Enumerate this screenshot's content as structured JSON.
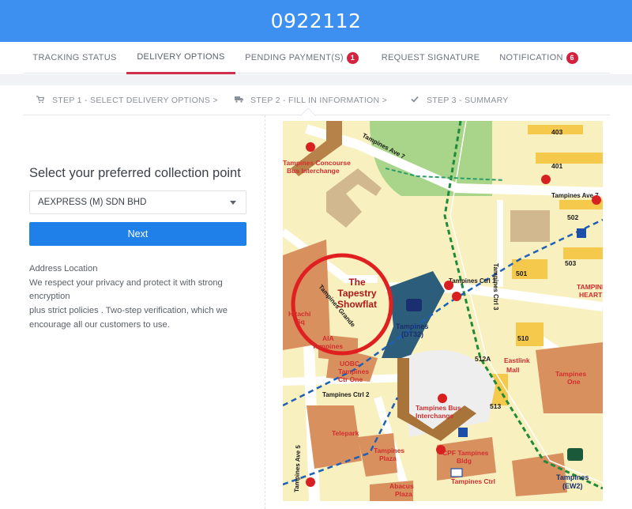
{
  "header": {
    "title": "0922112"
  },
  "tabs": [
    {
      "label": "TRACKING STATUS"
    },
    {
      "label": "DELIVERY OPTIONS"
    },
    {
      "label": "PENDING PAYMENT(S)",
      "badge": "1"
    },
    {
      "label": "REQUEST SIGNATURE"
    },
    {
      "label": "NOTIFICATION",
      "badge": "6"
    }
  ],
  "steps": [
    {
      "label": "STEP 1 - SELECT DELIVERY OPTIONS >",
      "icon": "cart-icon"
    },
    {
      "label": "STEP 2 - FILL IN INFORMATION >",
      "icon": "truck-icon"
    },
    {
      "label": "STEP 3 - SUMMARY",
      "icon": "check-icon"
    }
  ],
  "form": {
    "prompt": "Select your preferred collection point",
    "selected_option": "AEXPRESS (M) SDN BHD",
    "next_label": "Next"
  },
  "address": {
    "heading": "Address Location",
    "line1": "We respect your privacy and protect it with strong encryption",
    "line2": "plus strict policies . Two-step verification, which we encourage all our customers to use."
  },
  "map": {
    "highlight": [
      "The",
      "Tapestry",
      "Showflat"
    ],
    "roads": [
      "Tampines Ave 7",
      "Tampines Ave 5",
      "Tampines Ctrl 1",
      "Tampines Ctrl 2",
      "Tampines Ctrl 3",
      "Tampines Grande"
    ],
    "places": [
      "Tampines Concourse",
      "Bus Interchange",
      "Hitachi",
      "Sq",
      "AIA",
      "Tampines",
      "UOBC",
      "Tampines",
      "Ctr One",
      "Telepark",
      "Tampines",
      "Plaza",
      "Abacus",
      "Plaza",
      "Tampines Bus",
      "Interchange",
      "CPF Tampines",
      "Bldg",
      "Tampines Ctrl",
      "Eastlink",
      "Mall",
      "Tampines",
      "One",
      "TAMPINES",
      "HEART"
    ],
    "stations": [
      {
        "name": "Tampines",
        "code": "(DT32)"
      },
      {
        "name": "Tampines",
        "code": "(EW2)"
      }
    ],
    "blocks": [
      "403",
      "401",
      "502",
      "503",
      "501",
      "510",
      "512A",
      "513"
    ],
    "colors": {
      "road": "#ffffff",
      "land": "#f8f0bf",
      "park": "#a9d58a",
      "building": "#f5c94b",
      "mall": "#d9905f",
      "highlight": "#e02020"
    }
  }
}
